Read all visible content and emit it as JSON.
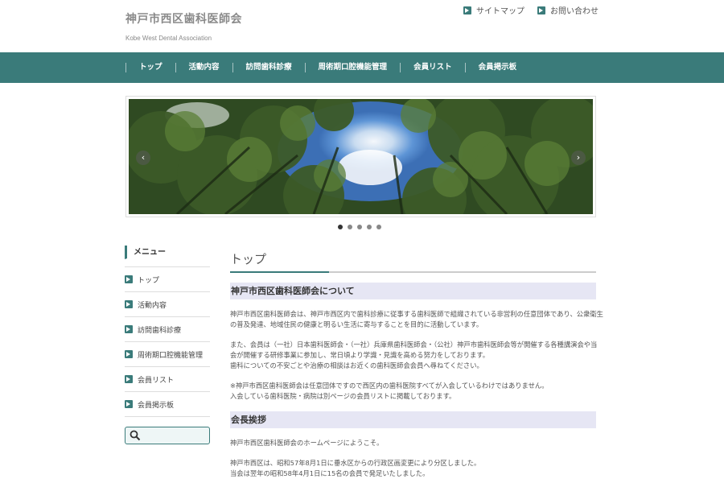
{
  "header": {
    "title": "神戸市西区歯科医師会",
    "subtitle": "Kobe West Dental Association",
    "links": [
      "サイトマップ",
      "お問い合わせ"
    ]
  },
  "nav": {
    "items": [
      "トップ",
      "活動内容",
      "訪問歯科診療",
      "周術期口腔機能管理",
      "会員リスト",
      "会員掲示板"
    ]
  },
  "slider": {
    "prev": "‹",
    "next": "›",
    "dots": 5,
    "active_dot": 0
  },
  "sidebar": {
    "heading": "メニュー",
    "items": [
      "トップ",
      "活動内容",
      "訪問歯科診療",
      "周術期口腔機能管理",
      "会員リスト",
      "会員掲示板"
    ],
    "search_placeholder": ""
  },
  "main": {
    "page_title": "トップ",
    "section1": {
      "heading": "神戸市西区歯科医師会について",
      "para1": [
        "神戸市西区歯科医師会は、神戸市西区内で歯科診療に従事する歯科医師で組織されている非営利の任意団体であり、公衆衛生",
        "の普及発達、地域住民の健康と明るい生活に寄与することを目的に活動しています。"
      ],
      "para2": [
        "また、会員は（一社）日本歯科医師会・（一社）兵庫県歯科医師会・（公社）神戸市歯科医師会等が開催する各種講演会や当",
        "会が開催する研修事業に参加し、常日頃より学識・見識を高める努力をしております。",
        "歯科についての不安ごとや治療の相談はお近くの歯科医師会会員へ尋ねてください。"
      ],
      "para3": [
        "※神戸市西区歯科医師会は任意団体ですので西区内の歯科医院すべてが入会しているわけではありません。",
        "入会している歯科医院・病院は別ページの会員リストに掲載しております。"
      ]
    },
    "section2": {
      "heading": "会長挨拶",
      "para1": [
        "神戸市西区歯科医師会のホームページにようこそ。"
      ],
      "para2": [
        "神戸市西区は、昭和57年8月1日に垂水区からの行政区画変更により分区しました。",
        "当会は翌年の昭和58年4月1日に15名の会員で発足いたしました。"
      ]
    }
  },
  "colors": {
    "brand": "#3a7b7a",
    "heading_bg": "#e6e6f4"
  }
}
